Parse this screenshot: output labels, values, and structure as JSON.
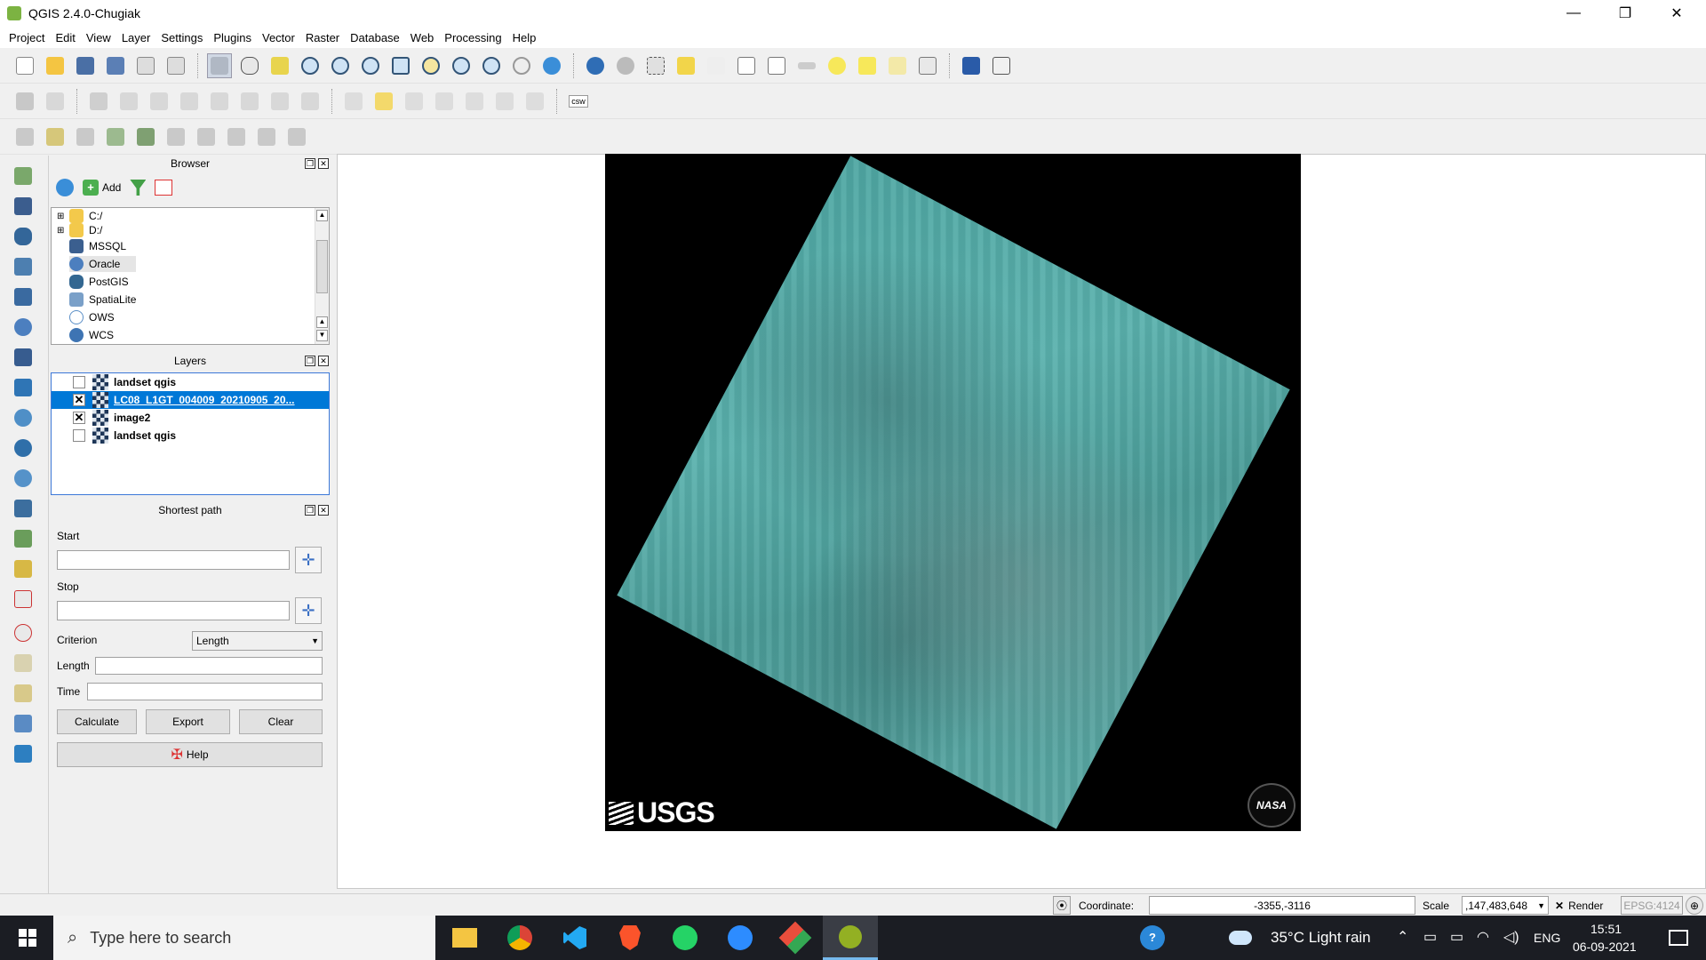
{
  "window": {
    "title": "QGIS 2.4.0-Chugiak",
    "minimize": "—",
    "restore": "❐",
    "close": "✕"
  },
  "menu": [
    "Project",
    "Edit",
    "View",
    "Layer",
    "Settings",
    "Plugins",
    "Vector",
    "Raster",
    "Database",
    "Web",
    "Processing",
    "Help"
  ],
  "toolbar2": {
    "csw_label": "csw"
  },
  "browser": {
    "title": "Browser",
    "add_label": "Add",
    "items": [
      "C:/",
      "D:/",
      "MSSQL",
      "Oracle",
      "PostGIS",
      "SpatiaLite",
      "OWS",
      "WCS"
    ]
  },
  "layers": {
    "title": "Layers",
    "rows": [
      {
        "name": "landset qgis",
        "checked": false,
        "selected": false
      },
      {
        "name": "LC08_L1GT_004009_20210905_20...",
        "checked": true,
        "selected": true
      },
      {
        "name": "image2",
        "checked": true,
        "selected": false
      },
      {
        "name": "landset qgis",
        "checked": false,
        "selected": false
      }
    ]
  },
  "shortest_path": {
    "title": "Shortest path",
    "start_label": "Start",
    "stop_label": "Stop",
    "criterion_label": "Criterion",
    "criterion_value": "Length",
    "length_label": "Length",
    "time_label": "Time",
    "calculate": "Calculate",
    "export": "Export",
    "clear": "Clear",
    "help": "Help"
  },
  "map": {
    "usgs_label": "USGS",
    "nasa_label": "NASA"
  },
  "status": {
    "coordinate_label": "Coordinate:",
    "coordinate_value": "-3355,-3116",
    "scale_label": "Scale",
    "scale_value": ",147,483,648",
    "render_label": "Render",
    "crs": "EPSG:4124"
  },
  "taskbar": {
    "search_placeholder": "Type here to search",
    "weather": "35°C  Light rain",
    "lang": "ENG",
    "time": "15:51",
    "date": "06-09-2021"
  }
}
